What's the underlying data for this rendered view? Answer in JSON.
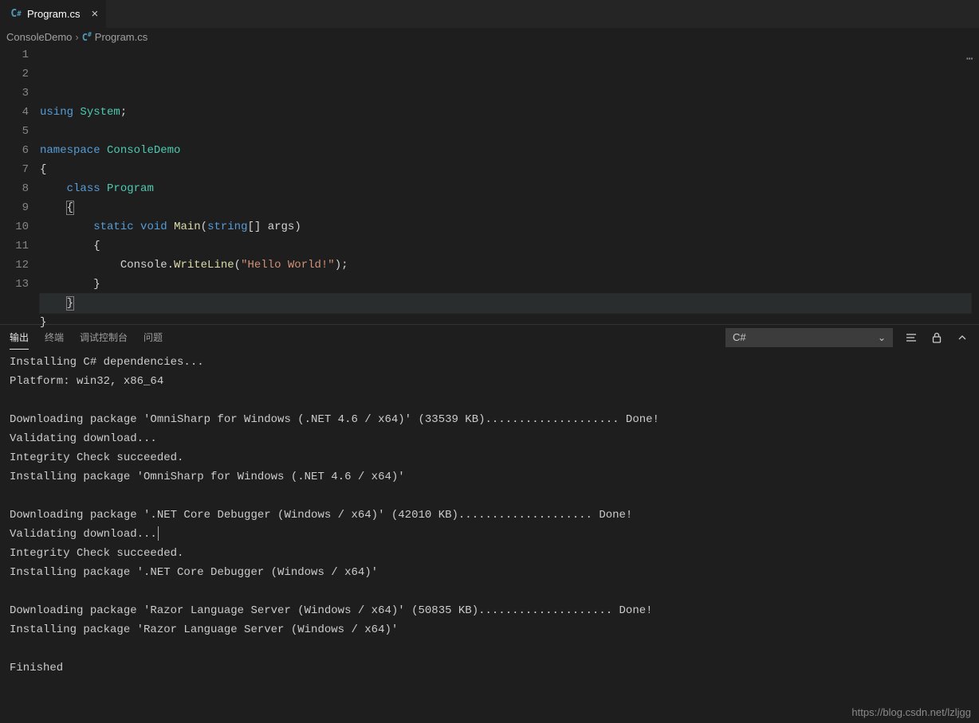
{
  "tab": {
    "filename": "Program.cs",
    "icon": "csharp-file-icon"
  },
  "breadcrumb": {
    "parent": "ConsoleDemo",
    "file": "Program.cs"
  },
  "code": {
    "language": "csharp",
    "current_line": 11,
    "lines": [
      {
        "n": 1,
        "tokens": [
          [
            "key",
            "using"
          ],
          [
            "punct",
            " "
          ],
          [
            "ns",
            "System"
          ],
          [
            "punct",
            ";"
          ]
        ]
      },
      {
        "n": 2,
        "tokens": []
      },
      {
        "n": 3,
        "tokens": [
          [
            "key",
            "namespace"
          ],
          [
            "punct",
            " "
          ],
          [
            "ns",
            "ConsoleDemo"
          ]
        ]
      },
      {
        "n": 4,
        "tokens": [
          [
            "punct",
            "{"
          ]
        ]
      },
      {
        "n": 5,
        "tokens": [
          [
            "punct",
            "    "
          ],
          [
            "key",
            "class"
          ],
          [
            "punct",
            " "
          ],
          [
            "type",
            "Program"
          ]
        ]
      },
      {
        "n": 6,
        "tokens": [
          [
            "punct",
            "    "
          ],
          [
            "punct",
            "{"
          ]
        ],
        "box": true
      },
      {
        "n": 7,
        "tokens": [
          [
            "punct",
            "        "
          ],
          [
            "key",
            "static"
          ],
          [
            "punct",
            " "
          ],
          [
            "key",
            "void"
          ],
          [
            "punct",
            " "
          ],
          [
            "func",
            "Main"
          ],
          [
            "punct",
            "("
          ],
          [
            "key",
            "string"
          ],
          [
            "punct",
            "[] "
          ],
          [
            "var",
            "args"
          ],
          [
            "punct",
            ")"
          ]
        ]
      },
      {
        "n": 8,
        "tokens": [
          [
            "punct",
            "        {"
          ]
        ]
      },
      {
        "n": 9,
        "tokens": [
          [
            "punct",
            "            "
          ],
          [
            "var",
            "Console"
          ],
          [
            "punct",
            "."
          ],
          [
            "func",
            "WriteLine"
          ],
          [
            "punct",
            "("
          ],
          [
            "str",
            "\"Hello World!\""
          ],
          [
            "punct",
            ");"
          ]
        ]
      },
      {
        "n": 10,
        "tokens": [
          [
            "punct",
            "        }"
          ]
        ]
      },
      {
        "n": 11,
        "tokens": [
          [
            "punct",
            "    "
          ],
          [
            "punct",
            "}"
          ]
        ],
        "box": true,
        "current": true
      },
      {
        "n": 12,
        "tokens": [
          [
            "punct",
            "}"
          ]
        ]
      },
      {
        "n": 13,
        "tokens": []
      }
    ]
  },
  "panel": {
    "tabs": [
      {
        "id": "output",
        "label": "输出",
        "active": true
      },
      {
        "id": "terminal",
        "label": "终端",
        "active": false
      },
      {
        "id": "debug",
        "label": "调试控制台",
        "active": false
      },
      {
        "id": "problems",
        "label": "问题",
        "active": false
      }
    ],
    "channel_selected": "C#",
    "output_lines": [
      "Installing C# dependencies...",
      "Platform: win32, x86_64",
      "",
      "Downloading package 'OmniSharp for Windows (.NET 4.6 / x64)' (33539 KB).................... Done!",
      "Validating download...",
      "Integrity Check succeeded.",
      "Installing package 'OmniSharp for Windows (.NET 4.6 / x64)'",
      "",
      "Downloading package '.NET Core Debugger (Windows / x64)' (42010 KB).................... Done!",
      "Validating download...",
      "Integrity Check succeeded.",
      "Installing package '.NET Core Debugger (Windows / x64)'",
      "",
      "Downloading package 'Razor Language Server (Windows / x64)' (50835 KB).................... Done!",
      "Installing package 'Razor Language Server (Windows / x64)'",
      "",
      "Finished"
    ],
    "icons": {
      "clear": "clear-all-icon",
      "lock": "lock-icon",
      "expand": "expand-icon"
    }
  },
  "watermark": "https://blog.csdn.net/lzljgg"
}
